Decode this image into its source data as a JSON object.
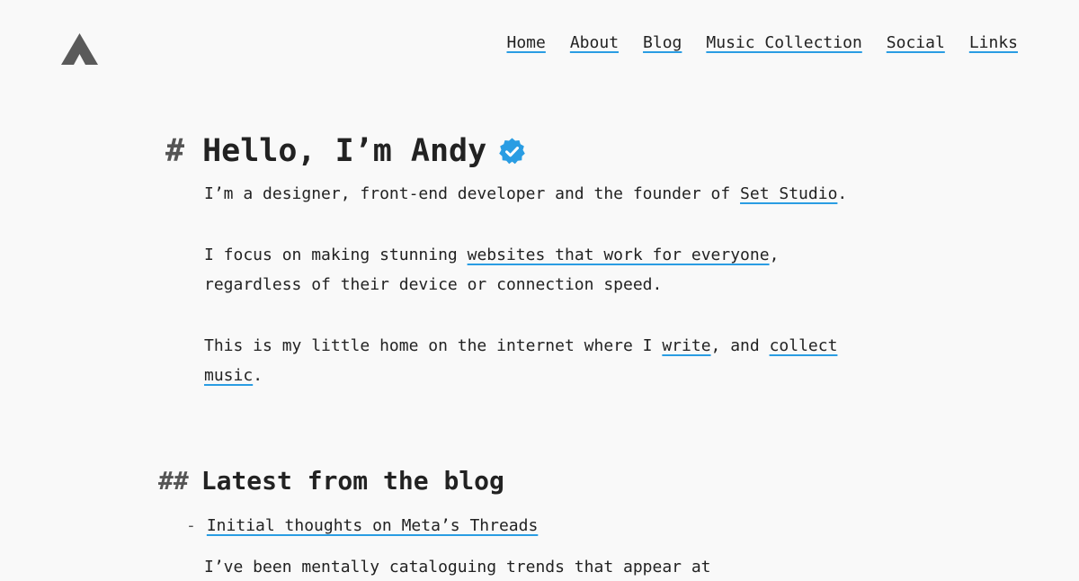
{
  "header": {
    "logo_name": "site-logo",
    "nav": [
      {
        "label": "Home"
      },
      {
        "label": "About"
      },
      {
        "label": "Blog"
      },
      {
        "label": "Music Collection"
      },
      {
        "label": "Social"
      },
      {
        "label": "Links"
      }
    ]
  },
  "hero": {
    "hash": "#",
    "title": "Hello, I’m Andy",
    "badge_icon": "verified-badge-icon",
    "p1_text": "I’m a designer, front-end developer and the founder of ",
    "p1_link": "Set Studio",
    "p1_end": ".",
    "p2_text": "I focus on making stunning ",
    "p2_link": "websites that work for everyone",
    "p2_end": ", regardless of their device or connection speed.",
    "p3_text": "This is my little home on the internet where I ",
    "p3_link1": "write",
    "p3_mid": ", and ",
    "p3_link2": "collect music",
    "p3_end": "."
  },
  "blog": {
    "hash": "##",
    "heading": "Latest from the blog",
    "dash": "-",
    "posts": [
      {
        "title": "Initial thoughts on Meta’s Threads"
      }
    ],
    "excerpt": "I’ve been mentally cataloguing trends that appear at"
  },
  "colors": {
    "background": "#f9f9f9",
    "text": "#222222",
    "link_underline": "#2a9de3",
    "badge": "#2a9de3"
  }
}
